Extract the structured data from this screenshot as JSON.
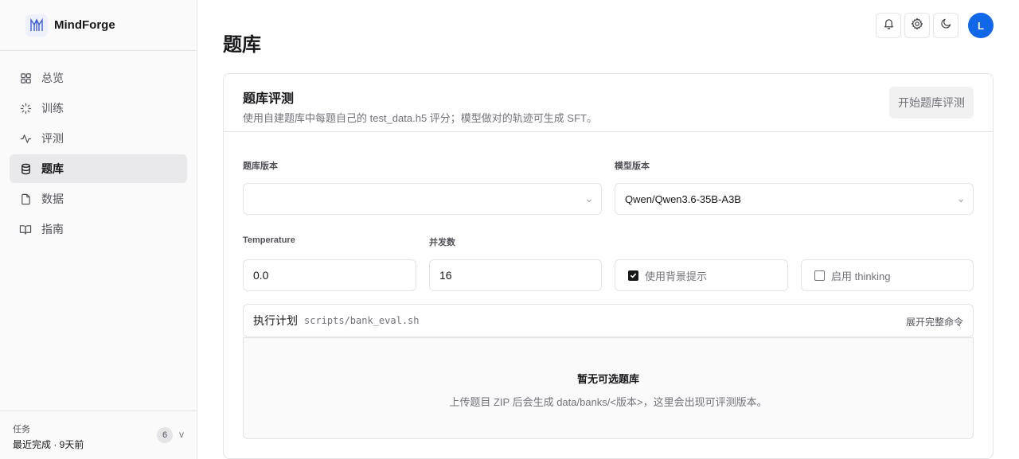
{
  "brand": {
    "name": "MindForge"
  },
  "nav": [
    {
      "label": "总览",
      "icon": "grid-icon"
    },
    {
      "label": "训练",
      "icon": "loader-icon"
    },
    {
      "label": "评测",
      "icon": "activity-icon"
    },
    {
      "label": "题库",
      "icon": "database-icon",
      "active": true
    },
    {
      "label": "数据",
      "icon": "file-icon"
    },
    {
      "label": "指南",
      "icon": "book-icon"
    }
  ],
  "tasks": {
    "title": "任务",
    "status": "最近完成 · 9天前",
    "count": "6",
    "toggle": "v"
  },
  "user": {
    "initial": "L"
  },
  "page": {
    "title": "题库"
  },
  "card": {
    "title": "题库评测",
    "description": "使用自建题库中每题自己的 test_data.h5 评分；模型做对的轨迹可生成 SFT。",
    "start_button": "开始题库评测"
  },
  "form": {
    "bank_version_label": "题库版本",
    "bank_version_value": "",
    "model_version_label": "模型版本",
    "model_version_value": "Qwen/Qwen3.6-35B-A3B",
    "temperature_label": "Temperature",
    "temperature_value": "0.0",
    "concurrency_label": "并发数",
    "concurrency_value": "16",
    "use_context_label": "使用背景提示",
    "use_context_checked": true,
    "thinking_label": "启用 thinking",
    "thinking_checked": false
  },
  "plan": {
    "label": "执行计划",
    "script": "scripts/bank_eval.sh",
    "expand": "展开完整命令"
  },
  "empty": {
    "title": "暂无可选题库",
    "description": "上传题目 ZIP 后会生成 data/banks/<版本>，这里会出现可评测版本。"
  },
  "colors": {
    "accent": "#1068e8",
    "brand_logo": "#3b5bdb"
  }
}
